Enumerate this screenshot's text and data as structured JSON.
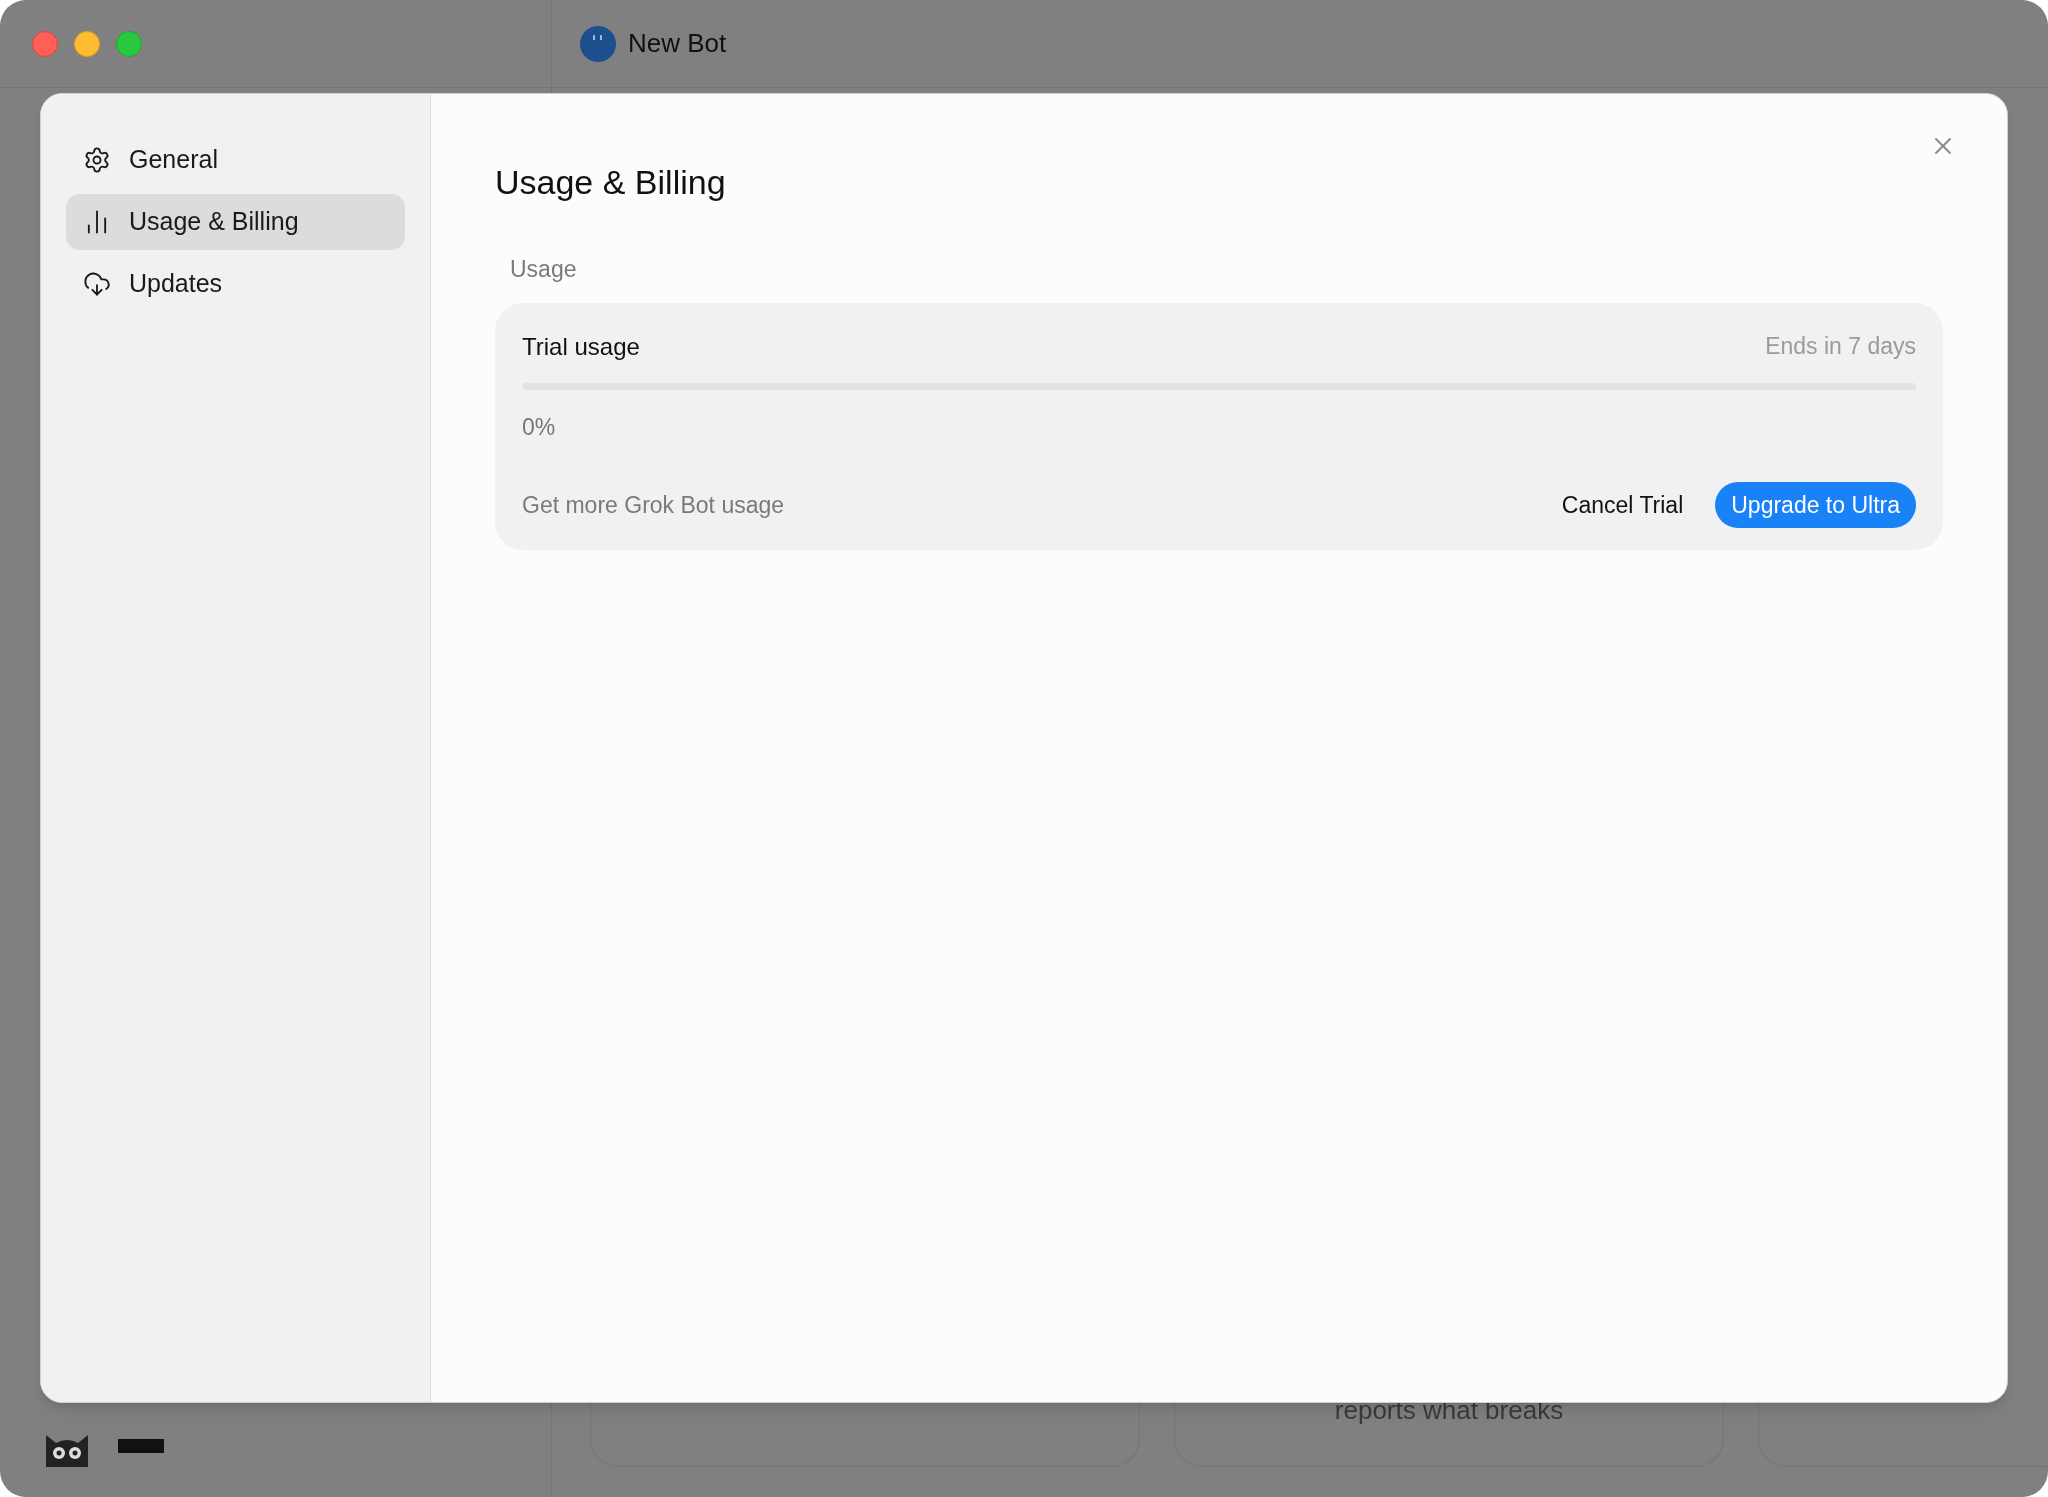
{
  "window": {
    "title": "New Bot"
  },
  "background": {
    "card_text": "reports what breaks"
  },
  "settings": {
    "sidebar": {
      "items": [
        {
          "label": "General",
          "selected": false
        },
        {
          "label": "Usage & Billing",
          "selected": true
        },
        {
          "label": "Updates",
          "selected": false
        }
      ]
    },
    "title": "Usage & Billing",
    "section": "Usage",
    "usage_card": {
      "title": "Trial usage",
      "ends": "Ends in 7 days",
      "level": 0,
      "percent": "0%",
      "hint": "Get more Grok Bot usage",
      "buttons": [
        {
          "label": "Cancel Trial",
          "kind": "text"
        },
        {
          "label": "Upgrade to Ultra",
          "kind": "primary"
        }
      ]
    }
  }
}
